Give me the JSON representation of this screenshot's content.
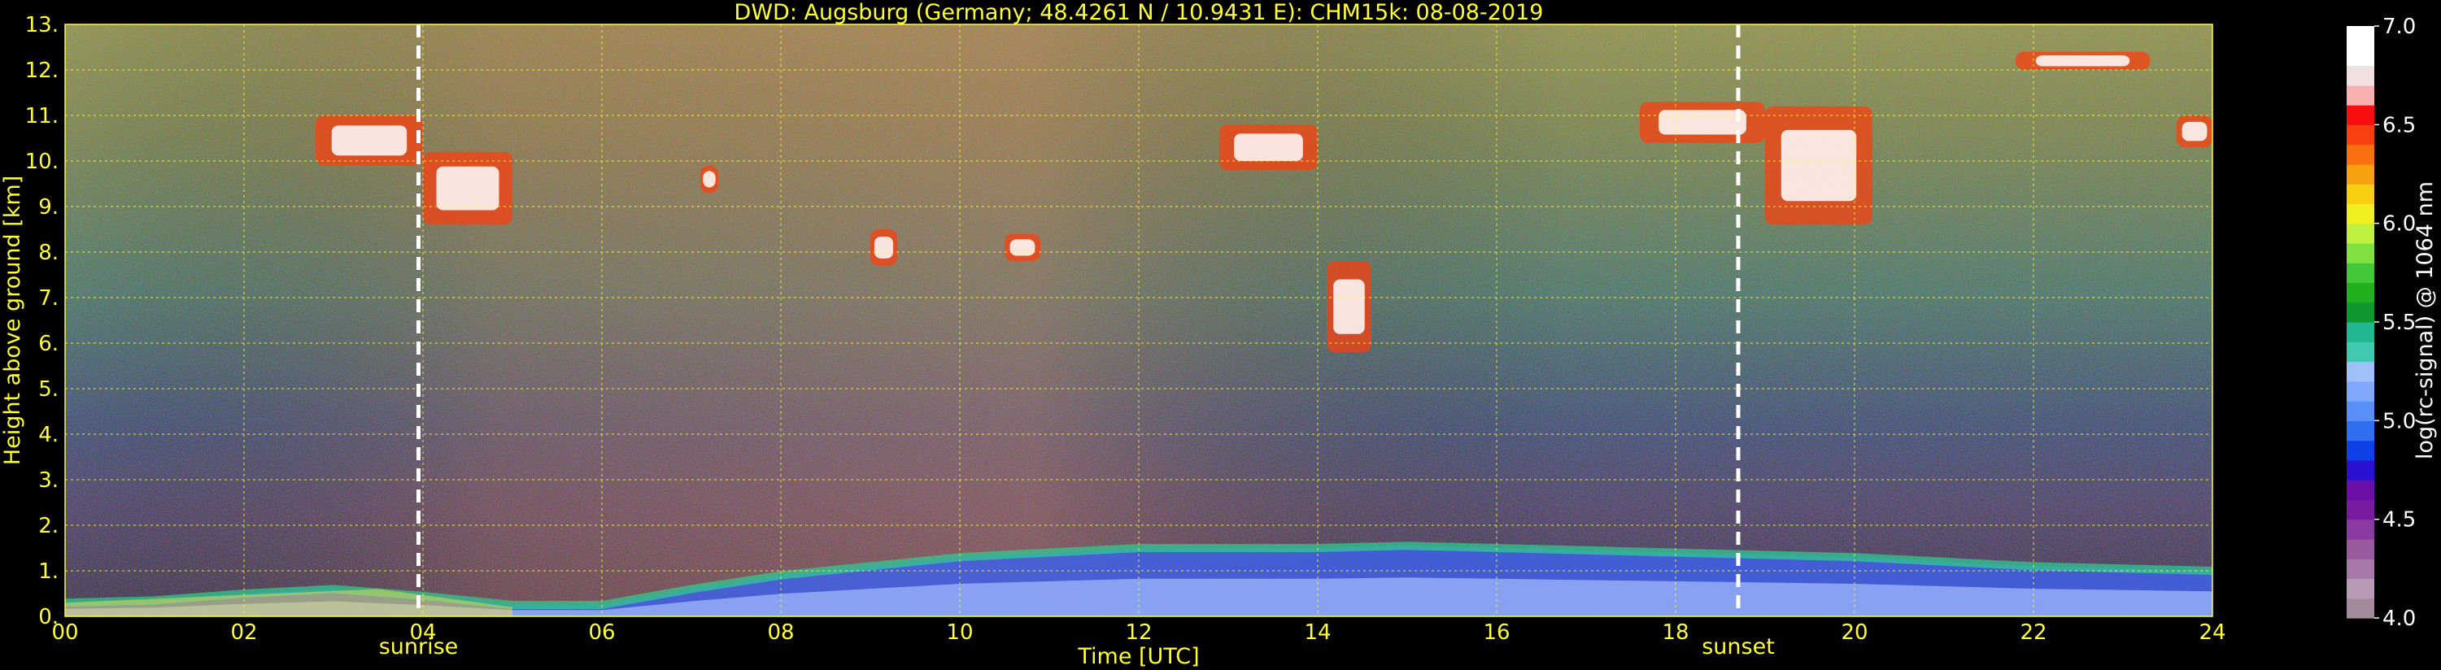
{
  "chart_data": {
    "type": "heatmap",
    "title": "DWD: Augsburg (Germany; 48.4261 N / 10.9431 E):    CHM15k: 08-08-2019",
    "xlabel": "Time [UTC]",
    "ylabel": "Height above ground [km]",
    "xlim": [
      0,
      24
    ],
    "ylim": [
      0,
      13
    ],
    "x_ticks": [
      "00",
      "02",
      "04",
      "06",
      "08",
      "10",
      "12",
      "14",
      "16",
      "18",
      "20",
      "22",
      "24"
    ],
    "y_ticks": [
      "0.",
      "1.",
      "2.",
      "3.",
      "4.",
      "5.",
      "6.",
      "7.",
      "8.",
      "9.",
      "10.",
      "11.",
      "12.",
      "13."
    ],
    "grid": true,
    "events": [
      {
        "label": "sunrise",
        "time": 3.95
      },
      {
        "label": "sunset",
        "time": 18.7
      }
    ],
    "colorbar": {
      "label": "log(rc-signal) @ 1064 nm",
      "range": [
        4.0,
        7.0
      ],
      "ticks": [
        "4.0",
        "4.5",
        "5.0",
        "5.5",
        "6.0",
        "6.5",
        "7.0"
      ],
      "colors": [
        "#a08a9c",
        "#b89ab4",
        "#a878a8",
        "#9a5aa0",
        "#8a3aa0",
        "#7a1aa0",
        "#6a10a8",
        "#2a10d0",
        "#1040e8",
        "#3070f0",
        "#5890f8",
        "#80a8fa",
        "#a0c0fc",
        "#40c8b0",
        "#20b890",
        "#109830",
        "#20b020",
        "#40c838",
        "#80e040",
        "#c0f040",
        "#f0f020",
        "#f8d010",
        "#f8a010",
        "#f87010",
        "#f84010",
        "#f81010",
        "#f8b0b0",
        "#f0e0e0",
        "#ffffff",
        "#ffffff"
      ]
    },
    "boundary_layer": {
      "times": [
        0,
        1,
        2,
        3,
        4,
        5,
        6,
        7,
        8,
        9,
        10,
        11,
        12,
        13,
        14,
        15,
        16,
        17,
        18,
        19,
        20,
        21,
        22,
        23,
        24
      ],
      "heights_km": [
        0.3,
        0.35,
        0.5,
        0.6,
        0.45,
        0.25,
        0.25,
        0.6,
        0.9,
        1.1,
        1.3,
        1.4,
        1.5,
        1.5,
        1.5,
        1.55,
        1.5,
        1.45,
        1.4,
        1.35,
        1.3,
        1.2,
        1.1,
        1.05,
        1.0
      ]
    },
    "cloud_layers": [
      {
        "t0": 2.8,
        "t1": 4.0,
        "z0": 9.9,
        "z1": 11.0
      },
      {
        "t0": 4.0,
        "t1": 5.0,
        "z0": 8.6,
        "z1": 10.2
      },
      {
        "t0": 7.1,
        "t1": 7.3,
        "z0": 9.3,
        "z1": 9.9
      },
      {
        "t0": 9.0,
        "t1": 9.3,
        "z0": 7.7,
        "z1": 8.5
      },
      {
        "t0": 10.5,
        "t1": 10.9,
        "z0": 7.8,
        "z1": 8.4
      },
      {
        "t0": 12.9,
        "t1": 14.0,
        "z0": 9.8,
        "z1": 10.8
      },
      {
        "t0": 14.1,
        "t1": 14.6,
        "z0": 5.8,
        "z1": 7.8
      },
      {
        "t0": 17.6,
        "t1": 19.0,
        "z0": 10.4,
        "z1": 11.3
      },
      {
        "t0": 19.0,
        "t1": 20.2,
        "z0": 8.6,
        "z1": 11.2
      },
      {
        "t0": 21.8,
        "t1": 23.3,
        "z0": 12.0,
        "z1": 12.4
      },
      {
        "t0": 23.6,
        "t1": 24.0,
        "z0": 10.3,
        "z1": 11.0
      }
    ]
  }
}
